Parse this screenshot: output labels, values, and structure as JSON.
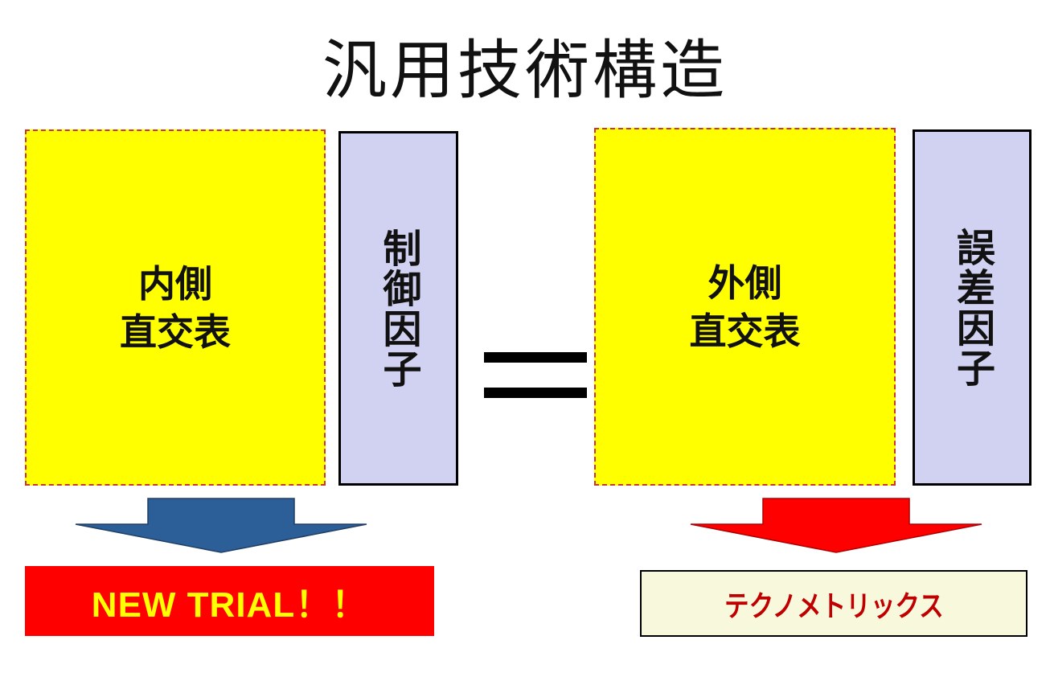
{
  "title": "汎用技術構造",
  "inner_array": {
    "line1": "内側",
    "line2": "直交表"
  },
  "control_factor": {
    "label": "制御因子"
  },
  "outer_array": {
    "line1": "外側",
    "line2": "直交表"
  },
  "noise_factor": {
    "label": "誤差因子"
  },
  "left_result": {
    "label": "NEW TRIAL！！"
  },
  "right_result": {
    "label": "テクノメトリックス"
  },
  "colors": {
    "array_fill": "#ffff00",
    "array_border": "#c8372d",
    "factor_fill": "#d1d1f1",
    "left_arrow": "#2c5f97",
    "right_arrow": "#ff0000",
    "left_banner_fill": "#ff0000",
    "left_banner_text": "#ffff00",
    "right_banner_fill": "#f8f8dc",
    "right_banner_text": "#c00000"
  }
}
